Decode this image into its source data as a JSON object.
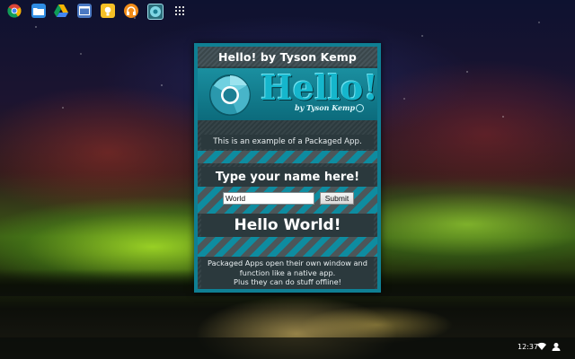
{
  "window": {
    "title": "Hello! by Tyson Kemp"
  },
  "banner": {
    "hello": "Hello!",
    "byline": "by Tyson Kemp"
  },
  "content": {
    "intro": "This is an example of a Packaged App.",
    "prompt": "Type your name here!",
    "name_value": "World",
    "submit_label": "Submit",
    "greeting": "Hello World!",
    "info_lines": [
      "Packaged Apps open their own window and",
      "function like a native app.",
      "Plus they can do stuff offline!"
    ]
  },
  "shelf": {
    "apps": [
      "chrome-icon",
      "files-icon",
      "drive-icon",
      "window-icon",
      "keep-icon",
      "music-icon",
      "hello-app-icon",
      "app-launcher-icon"
    ],
    "clock": "12:37"
  },
  "colors": {
    "window_border": "#0f7f93",
    "panel": "#2b393d",
    "stripe_teal": "#0e8ca0",
    "stripe_gray": "#4c5659"
  }
}
